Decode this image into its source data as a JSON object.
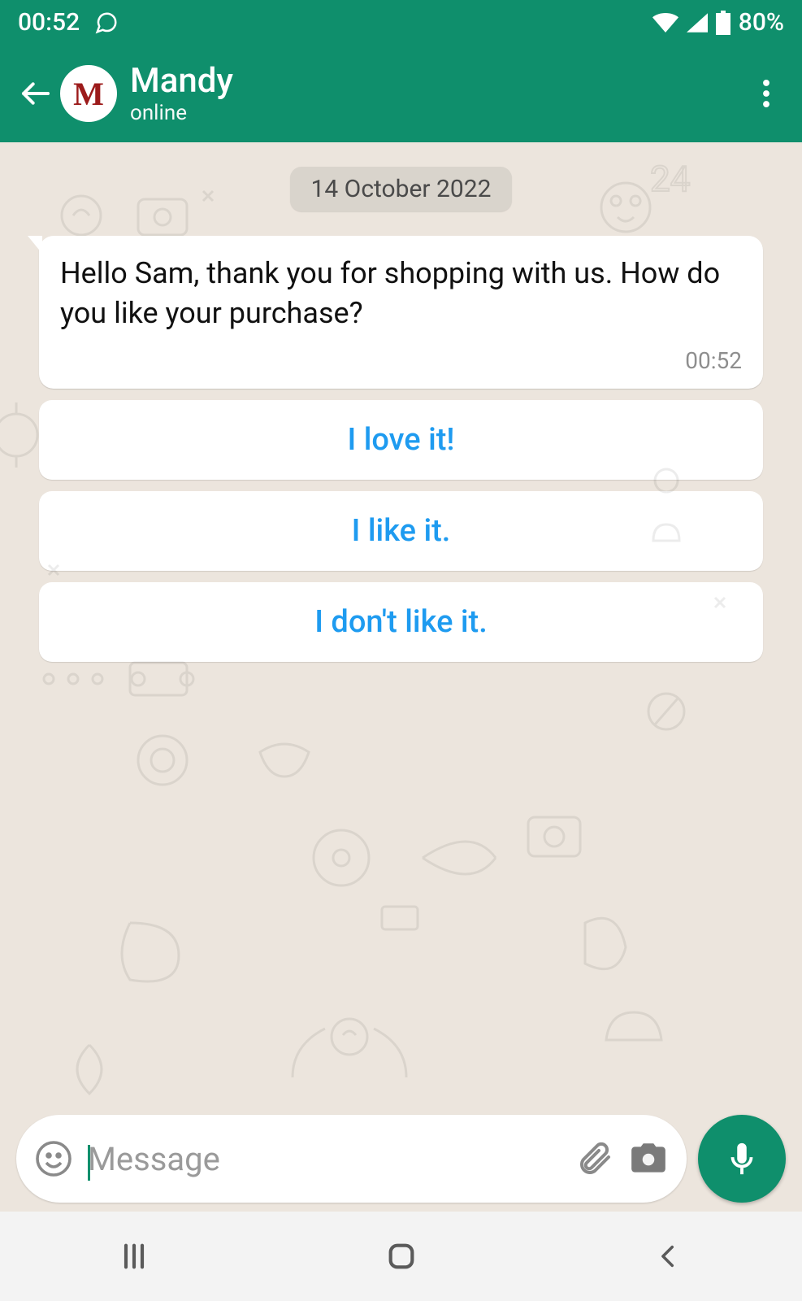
{
  "status": {
    "time": "00:52",
    "battery_pct": "80%"
  },
  "header": {
    "avatar_letter": "M",
    "contact_name": "Mandy",
    "contact_status": "online"
  },
  "chat": {
    "date_label": "14 October 2022",
    "message_text": "Hello Sam, thank you for shopping with us. How do you like your purchase?",
    "message_time": "00:52",
    "reply_options": [
      "I love it!",
      "I like it.",
      "I don't like it."
    ]
  },
  "input": {
    "placeholder": "Message"
  }
}
